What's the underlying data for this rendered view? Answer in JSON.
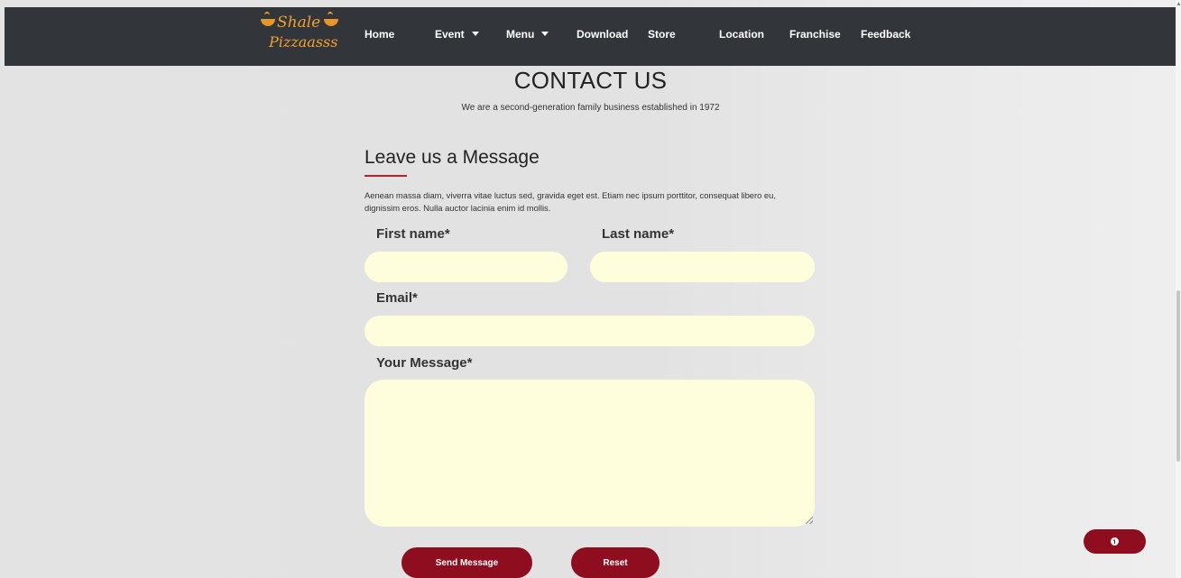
{
  "brand": {
    "logo_line1": "Shale",
    "logo_line2": "Pizzaasss",
    "logo_color": "#f0a030"
  },
  "nav": {
    "items": [
      {
        "label": "Home",
        "has_dropdown": false
      },
      {
        "label": "Event",
        "has_dropdown": true
      },
      {
        "label": "Menu",
        "has_dropdown": true
      },
      {
        "label": "Download",
        "has_dropdown": false
      },
      {
        "label": "Store",
        "has_dropdown": false
      },
      {
        "label": "Location",
        "has_dropdown": false
      },
      {
        "label": "Franchise",
        "has_dropdown": false
      },
      {
        "label": "Feedback",
        "has_dropdown": false
      }
    ],
    "background": "#32363a"
  },
  "page": {
    "title": "CONTACT US",
    "subtitle": "We are a second-generation family business established in 1972"
  },
  "form": {
    "heading": "Leave us a Message",
    "description": "Aenean massa diam, viverra vitae luctus sed, gravida eget est. Etiam nec ipsum porttitor, consequat libero eu, dignissim eros. Nulla auctor lacinia enim id mollis.",
    "first_name_label": "First name*",
    "first_name_value": "",
    "last_name_label": "Last name*",
    "last_name_value": "",
    "email_label": "Email*",
    "email_value": "",
    "message_label": "Your Message*",
    "message_value": "",
    "field_color": "#fffedc",
    "send_label": "Send Message",
    "reset_label": "Reset",
    "button_color": "#8e0d1e",
    "accent_color": "#b3202a"
  },
  "scroll_top": {
    "icon": "arrow-up-circle-icon"
  }
}
